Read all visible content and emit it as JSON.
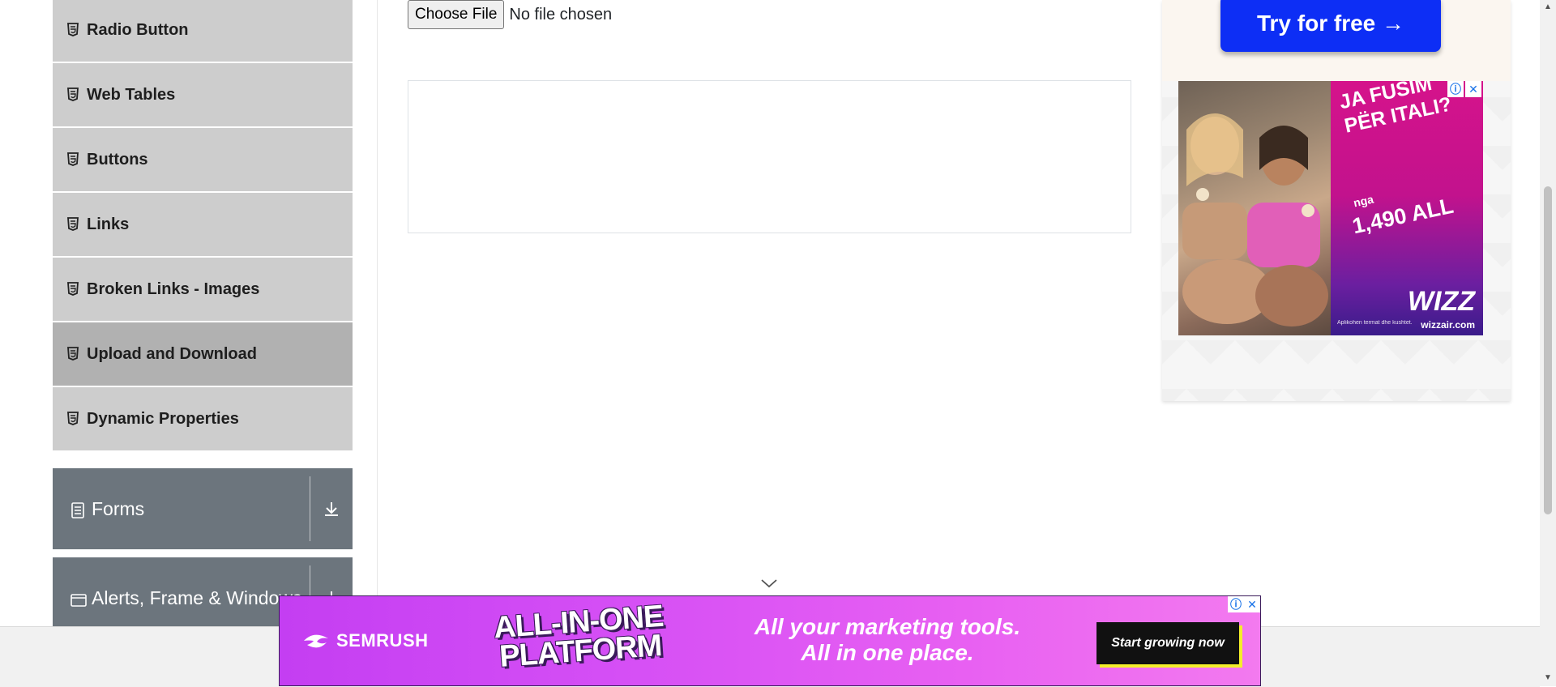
{
  "sidebar": {
    "items": [
      {
        "label": "Radio Button",
        "active": false
      },
      {
        "label": "Web Tables",
        "active": false
      },
      {
        "label": "Buttons",
        "active": false
      },
      {
        "label": "Links",
        "active": false
      },
      {
        "label": "Broken Links - Images",
        "active": false
      },
      {
        "label": "Upload and Download",
        "active": true
      },
      {
        "label": "Dynamic Properties",
        "active": false
      }
    ],
    "groups": [
      {
        "label": "Forms"
      },
      {
        "label": "Alerts, Frame & Windows"
      }
    ]
  },
  "main": {
    "upload": {
      "button_label": "Choose File",
      "status_text": "No file chosen"
    }
  },
  "ads": {
    "right_top": {
      "cta": "Try for free →"
    },
    "wizz": {
      "headline": "JA FUSIM PËR ITALI?",
      "from_label": "nga",
      "price": "1,490 ALL",
      "logo": "WIZZ",
      "domain": "wizzair.com",
      "fine_print": "Aplikohen termat dhe kushtet."
    },
    "semrush": {
      "brand": "SEMRUSH",
      "headline_line1": "ALL-IN-ONE",
      "headline_line2": "PLATFORM",
      "tagline_line1": "All your marketing tools.",
      "tagline_line2": "All in one place.",
      "cta": "Start growing now"
    },
    "info_glyph": "ⓘ",
    "close_glyph": "✕"
  },
  "colors": {
    "menu_bg": "#cdcdcd",
    "menu_active_bg": "#b1b1b1",
    "group_bg": "#6c757d",
    "try_free_blue": "#0d2ef5"
  }
}
